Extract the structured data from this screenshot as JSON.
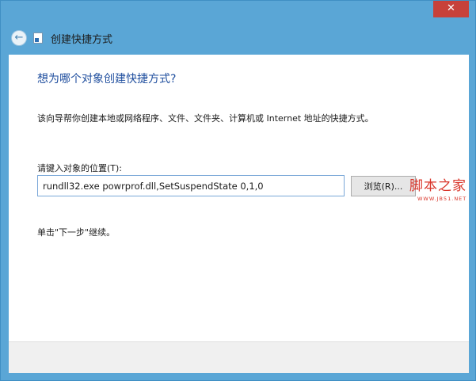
{
  "window": {
    "close_label": "✕",
    "title": "创建快捷方式",
    "back_icon": "←"
  },
  "wizard": {
    "heading": "想为哪个对象创建快捷方式?",
    "description": "该向导帮你创建本地或网络程序、文件、文件夹、计算机或 Internet 地址的快捷方式。",
    "location_label": "请键入对象的位置(T):",
    "location_value": "rundll32.exe powrprof.dll,SetSuspendState 0,1,0",
    "browse_label": "浏览(R)...",
    "continue_text": "单击\"下一步\"继续。"
  },
  "watermark": {
    "name": "脚本之家",
    "url": "WWW.JB51.NET"
  },
  "colors": {
    "accent": "#5aa6d6",
    "close": "#c7413a",
    "heading": "#1f4e9e",
    "watermark": "#d9352a"
  }
}
